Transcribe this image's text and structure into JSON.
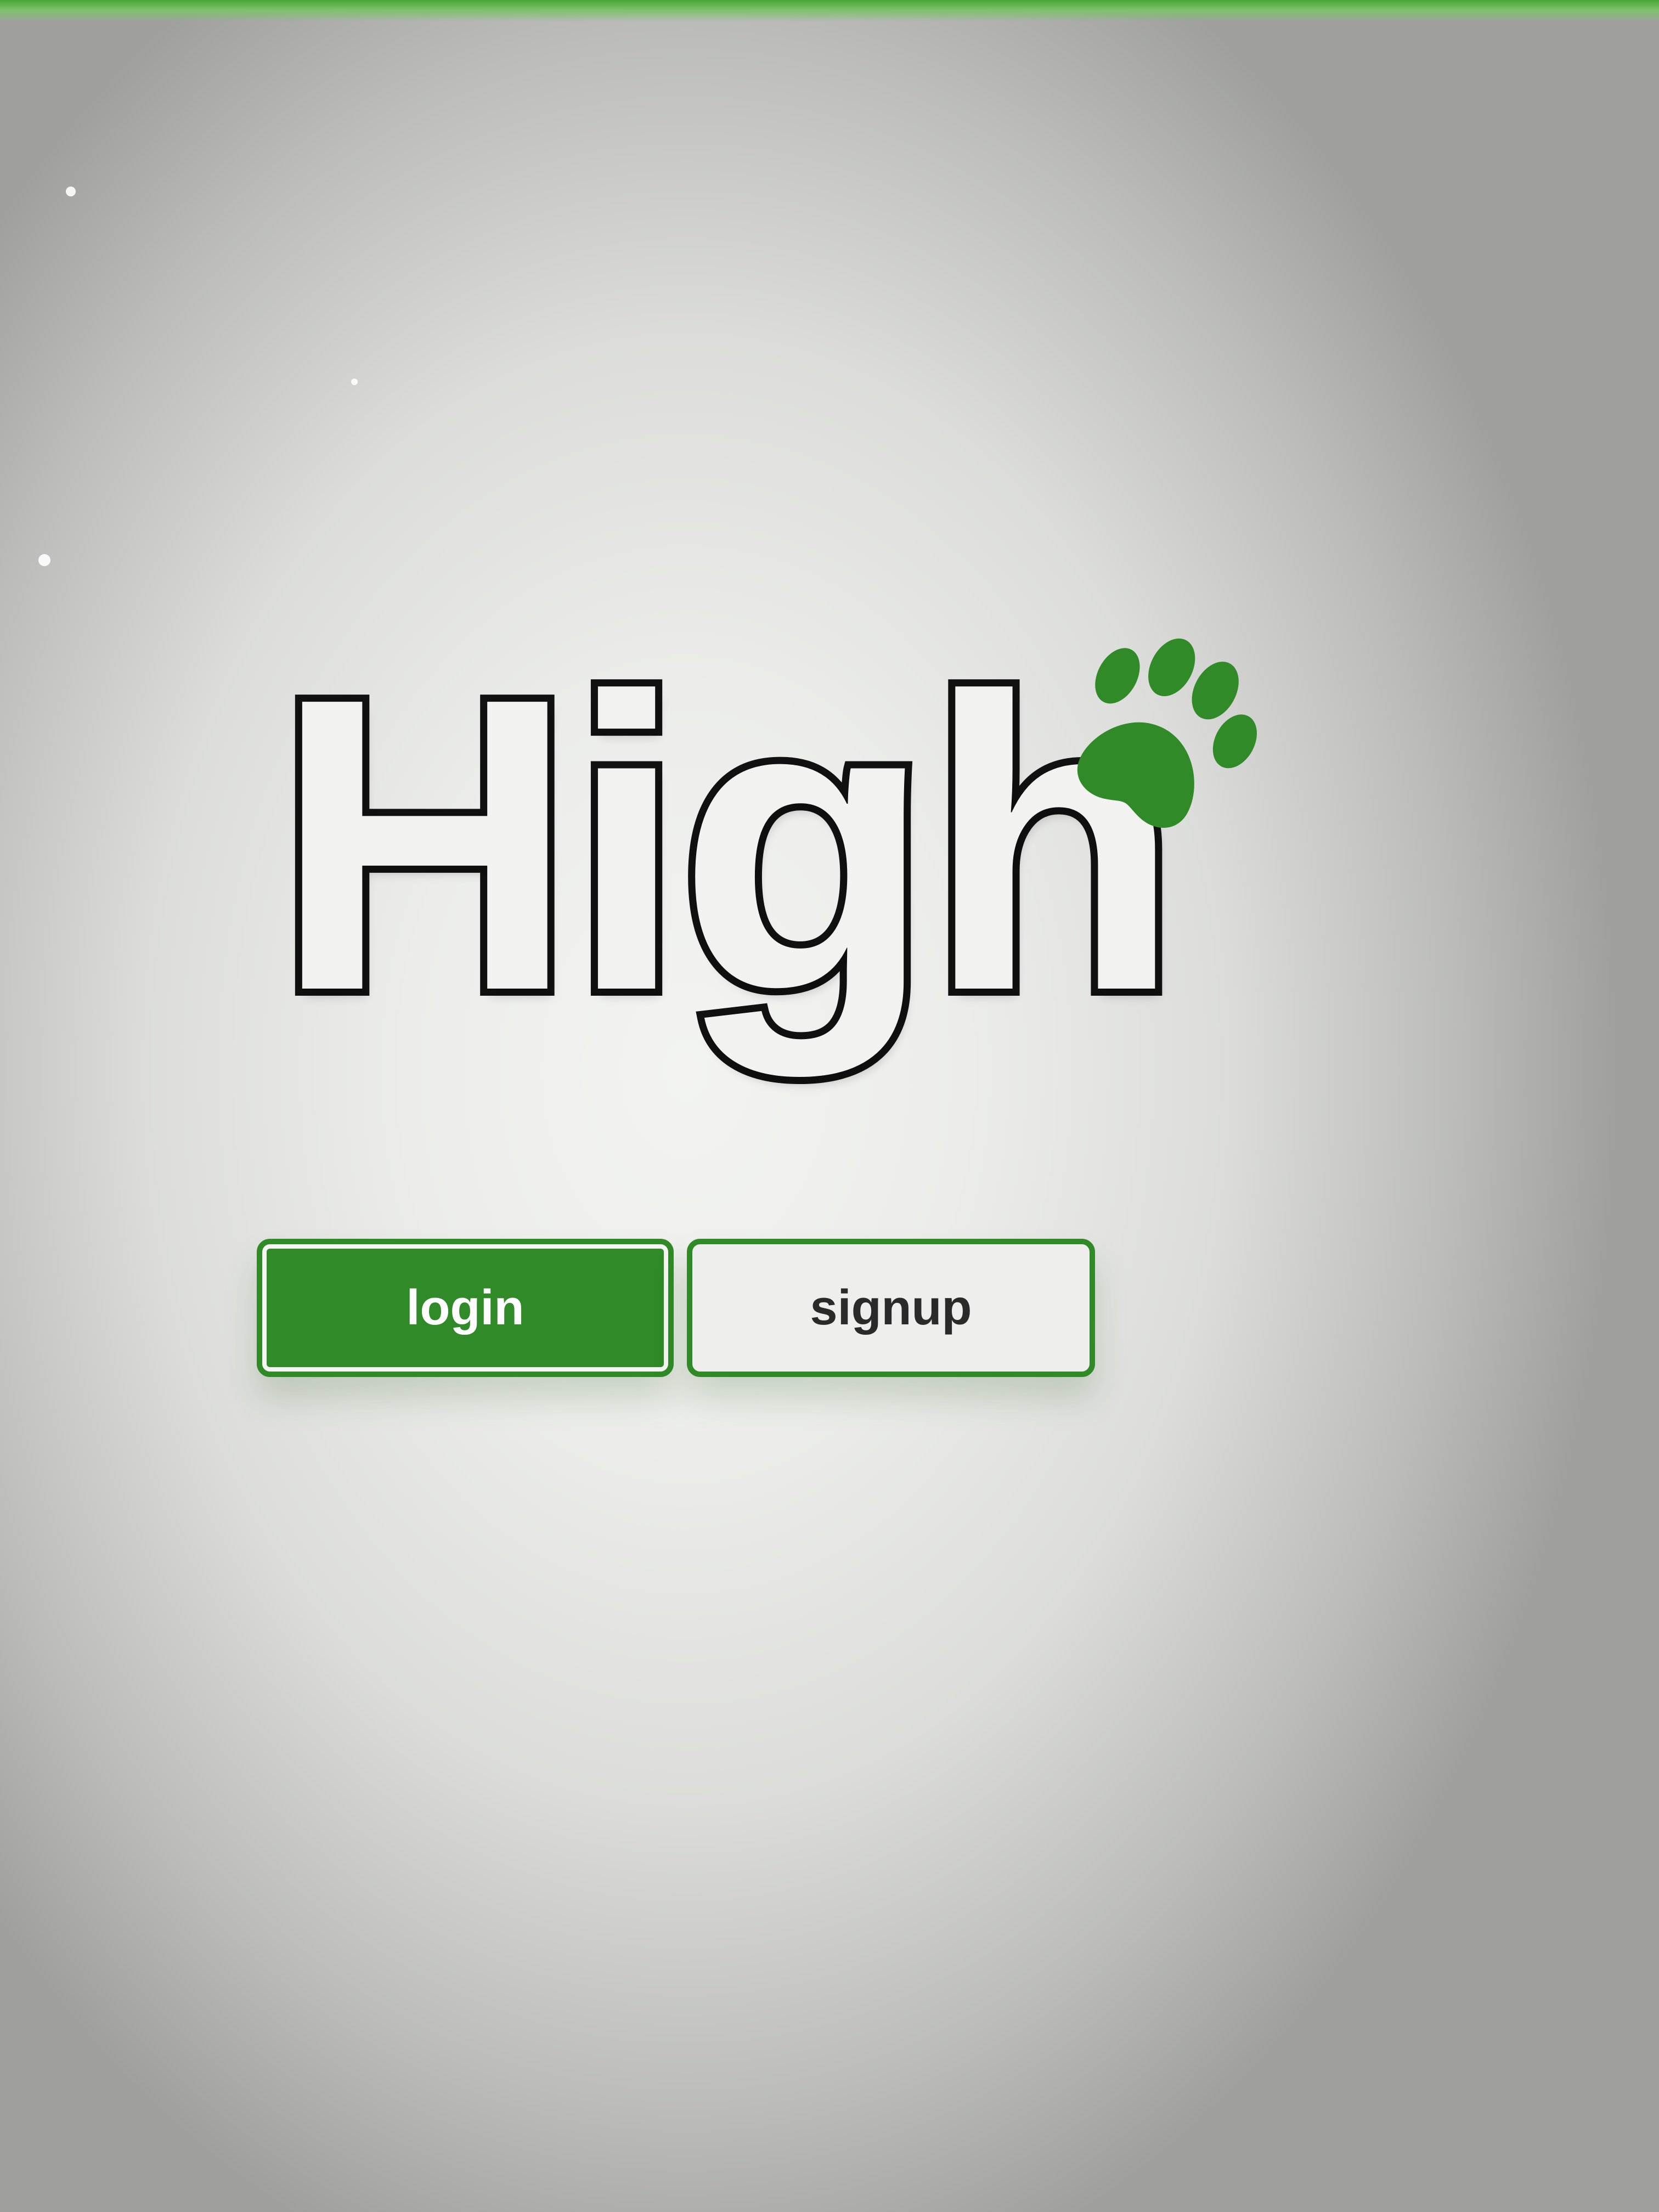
{
  "hero": {
    "title": "High"
  },
  "buttons": {
    "login_label": "login",
    "signup_label": "signup"
  },
  "icons": {
    "logo": "paw-print-icon"
  },
  "colors": {
    "brand_green": "#2f8a27",
    "title_stroke": "#111111",
    "signup_text": "#2a2a2a"
  }
}
